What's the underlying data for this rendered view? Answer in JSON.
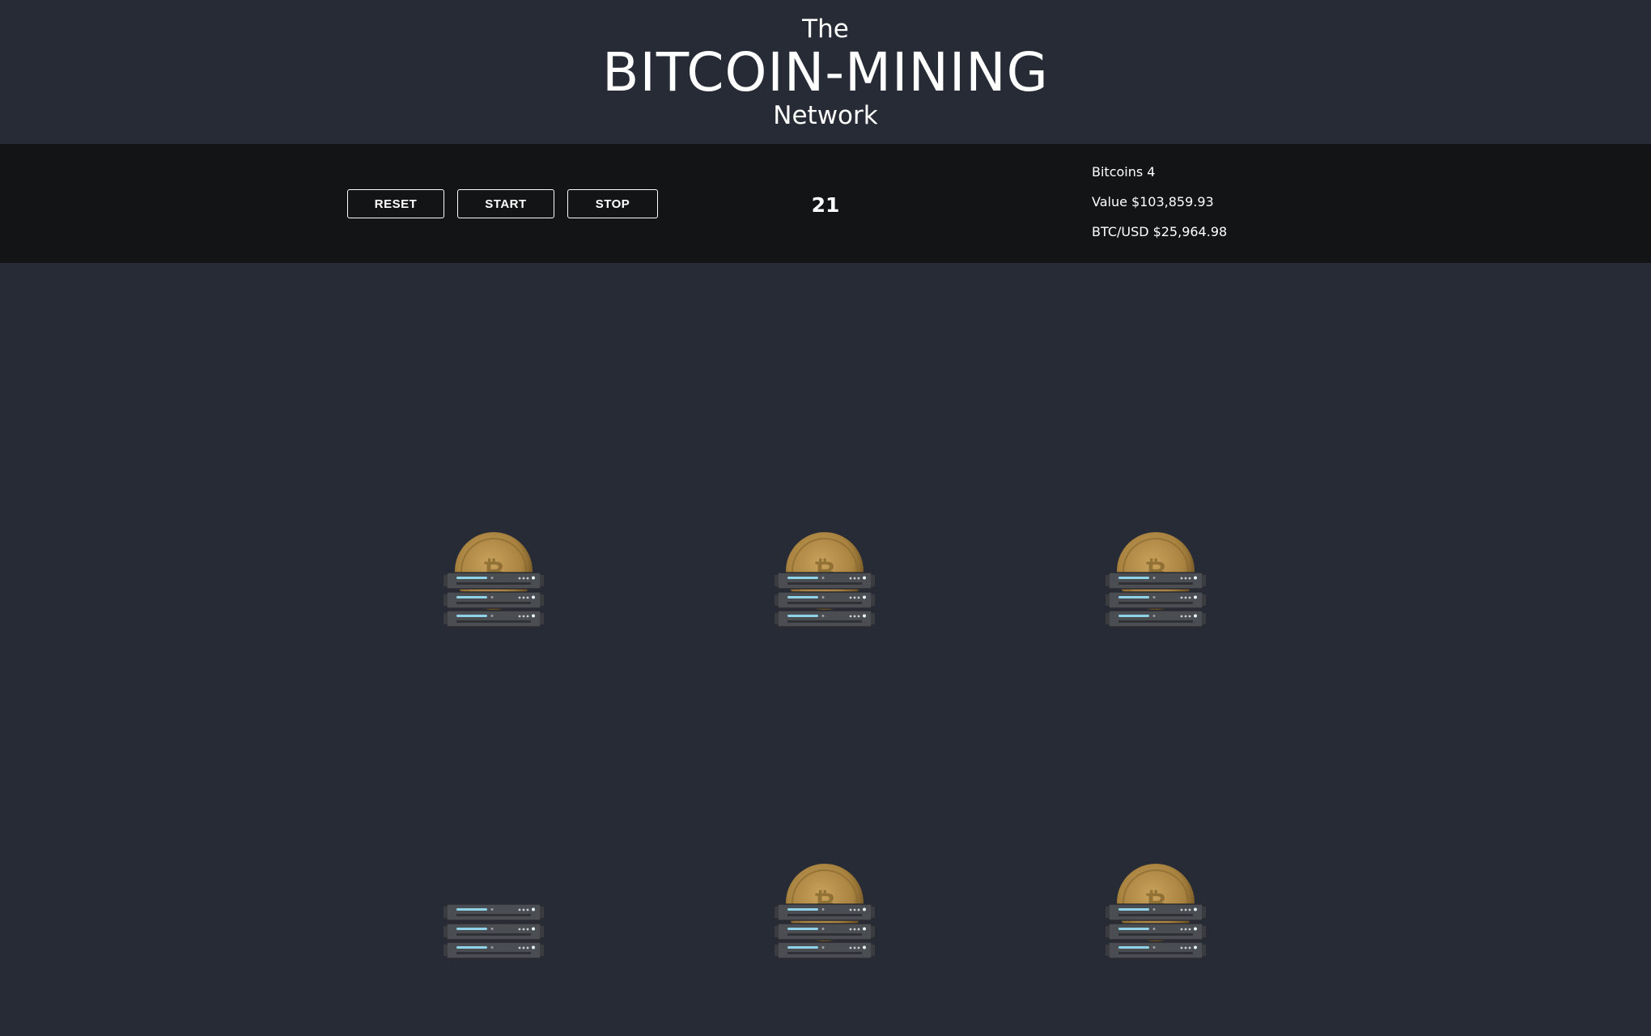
{
  "header": {
    "title_top": "The",
    "title_main": "BITCOIN-MINING",
    "title_bottom": "Network"
  },
  "controls": {
    "reset_label": "RESET",
    "start_label": "START",
    "stop_label": "STOP",
    "counter": "21"
  },
  "stats": {
    "bitcoins_label": "Bitcoins",
    "bitcoins_value": "4",
    "value_label": "Value",
    "value_amount": "$103,859.93",
    "rate_label": "BTC/USD",
    "rate_amount": "$25,964.98"
  },
  "miners": [
    {
      "icon": "server-rack-icon",
      "has_coin": true
    },
    {
      "icon": "server-rack-icon",
      "has_coin": true
    },
    {
      "icon": "server-rack-icon",
      "has_coin": true
    },
    {
      "icon": "server-rack-icon",
      "has_coin": false
    },
    {
      "icon": "server-rack-icon",
      "has_coin": true
    },
    {
      "icon": "server-rack-icon",
      "has_coin": true
    }
  ],
  "colors": {
    "background": "#262b35",
    "toolbar": "#131415",
    "coin": "#a8823f",
    "server": "#4a4d52",
    "server_led": "#8fd3e8"
  }
}
